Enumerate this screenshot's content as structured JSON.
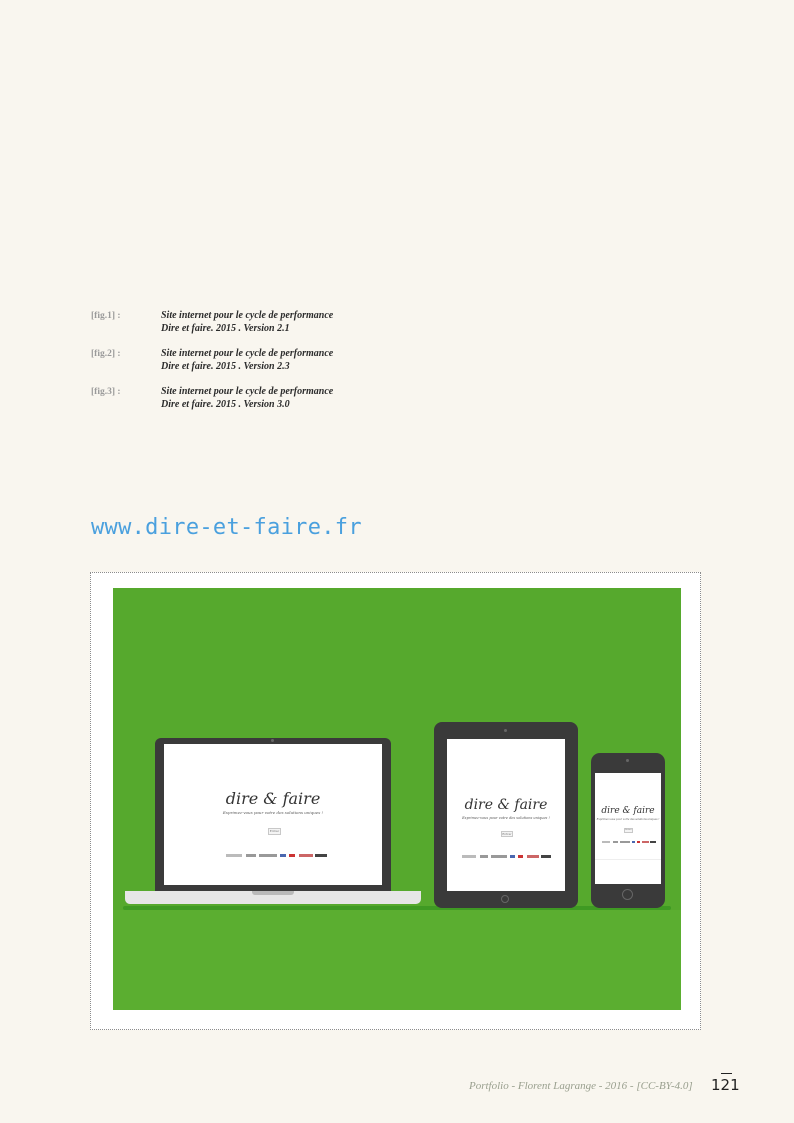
{
  "captions": [
    {
      "label": "[fig.1] :",
      "line1": "Site internet pour le cycle de performance",
      "line2": "Dire et faire. 2015 . Version 2.1"
    },
    {
      "label": "[fig.2] :",
      "line1": "Site internet pour le cycle de performance",
      "line2": "Dire et faire. 2015 . Version 2.3"
    },
    {
      "label": "[fig.3] :",
      "line1": "Site internet pour le cycle de performance",
      "line2": "Dire et faire. 2015 . Version 3.0"
    }
  ],
  "url": "www.dire-et-faire.fr",
  "mockup": {
    "logo": "dire & faire",
    "tagline": "Exprimez-vous pour votre des solutions uniques !",
    "button": "Entrer",
    "background_color": "#56a92d",
    "device_color": "#3a3a3a"
  },
  "footer": {
    "credit": "Portfolio - Florent Lagrange - 2016 - [CC-BY-4.0]",
    "page_number": "121"
  }
}
